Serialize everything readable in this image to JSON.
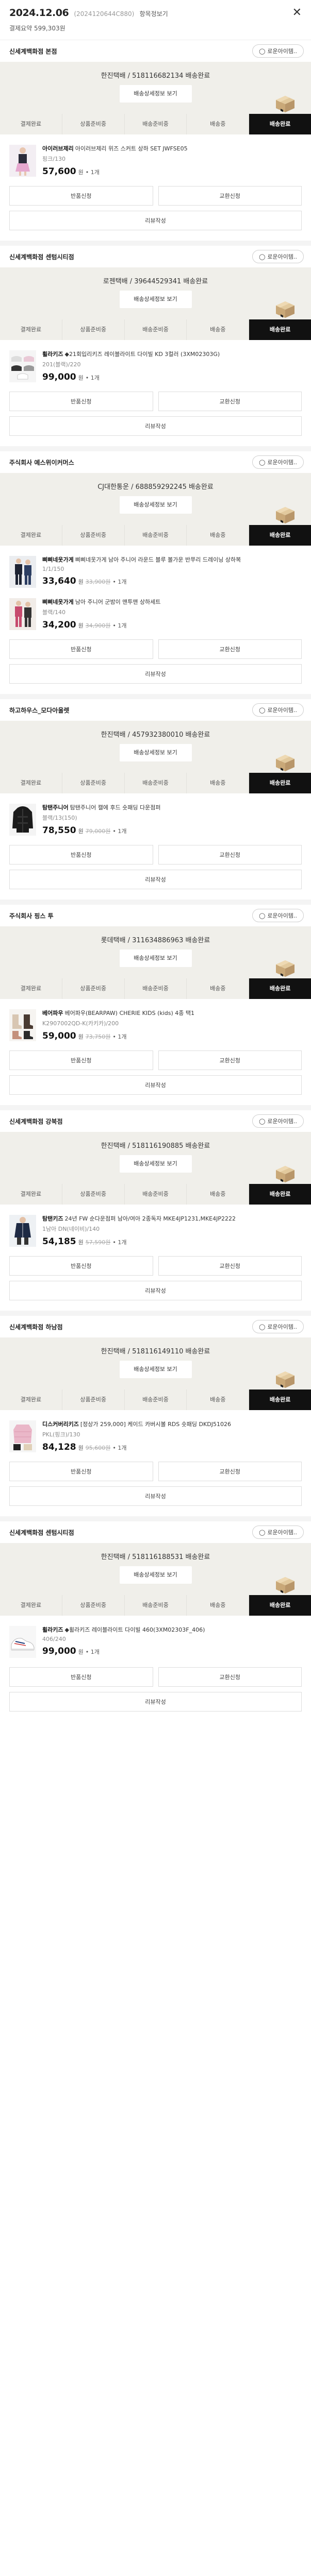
{
  "header": {
    "date": "2024.12.06",
    "order_no": "(2024120644C880)",
    "detail_link": "항목정보기",
    "payment_label": "결제요약",
    "payment_amount": "599,303원"
  },
  "labels": {
    "track_button": "배송상세정보 보기",
    "exchange_return_button": "반품신청",
    "exchange_button": "교환신청",
    "review_button": "리뷰작성",
    "shop_inquiry_button": "로운아이템..",
    "steps": [
      "결제완료",
      "상품준비중",
      "배송준비중",
      "배송중",
      "배송완료"
    ],
    "active_step": 4
  },
  "shops": [
    {
      "shop_name": "신세계백화점 본점",
      "carrier": "한진택배 / 518116682134 배송완료",
      "items": [
        {
          "brand": "아이러브제리",
          "name": "아이러브제리 위즈 스커트 상하 SET JWFSE05",
          "option": "핑크/130",
          "price": "57,600",
          "orig": "",
          "qty": "1개",
          "thumb": "pink"
        }
      ]
    },
    {
      "shop_name": "신세계백화점 센텀시티점",
      "carrier": "로젠택배 / 39644529341 배송완료",
      "items": [
        {
          "brand": "휠라키즈",
          "name": "◆21회입리키즈 레이블라이트 다이빌 KD 3컬러 (3XM02303G)",
          "option": "201(블랙)/220",
          "price": "99,000",
          "orig": "",
          "qty": "1개",
          "thumb": "shoes"
        }
      ]
    },
    {
      "shop_name": "주식회사 예스위이커머스",
      "carrier": "CJ대한통운 / 688859292245 배송완료",
      "items": [
        {
          "brand": "삐삐네옷가게",
          "name": "삐삐네옷가게 남아 주니어 라운드 블루 볼가운 반쭈리 드레이닝 상하복",
          "option": "1/1/150",
          "price": "33,640",
          "orig": "33,900원",
          "qty": "1개",
          "thumb": "black"
        },
        {
          "brand": "삐삐네옷가게",
          "name": "남아 주니어 군밤이 맨투맨 상하세트",
          "option": "블랙/140",
          "price": "34,200",
          "orig": "34,900원",
          "qty": "1개",
          "thumb": "pinkset"
        }
      ]
    },
    {
      "shop_name": "하고하우스_모다아울렛",
      "carrier": "한진택배 / 457932380010 배송완료",
      "items": [
        {
          "brand": "탐탠주니어",
          "name": "탐탠주니어 캘에 후드 숏패딩 다운점퍼",
          "option": "블랙/13(150)",
          "price": "78,550",
          "orig": "79,000원",
          "qty": "1개",
          "thumb": "jacket"
        }
      ]
    },
    {
      "shop_name": "주식회사 핑스 투",
      "carrier": "롯데택배 / 311634886963 배송완료",
      "items": [
        {
          "brand": "베어파우",
          "name": "베어파우(BEARPAW) CHERIE KIDS (kids) 4종 택1",
          "option": "K2907002QD-K(카키카)/200",
          "price": "59,000",
          "orig": "73,750원",
          "qty": "1개",
          "thumb": "boots"
        }
      ]
    },
    {
      "shop_name": "신세계백화점 강북점",
      "carrier": "한진택배 / 518116190885 배송완료",
      "items": [
        {
          "brand": "탐탠키즈",
          "name": "24년 FW 순다운점퍼 남아/여아 2종독자 MKE4JP1231,MKE4JP2222",
          "option": "1남아 DN(네이비)/140",
          "price": "54,185",
          "orig": "57,590원",
          "qty": "1개",
          "thumb": "parka"
        }
      ]
    },
    {
      "shop_name": "신세계백화점 하남점",
      "carrier": "한진택배 / 518116149110 배송완료",
      "items": [
        {
          "brand": "디스커버리키즈",
          "name": "[정상가 259,000] 케이드 카버시볼 RDS 숏패딩 DKDJ51026",
          "option": "PKL(핑크)/130",
          "price": "84,128",
          "orig": "95,600원",
          "qty": "1개",
          "thumb": "puffer"
        }
      ]
    },
    {
      "shop_name": "신세계백화점 센텀시티점",
      "carrier": "한진택배 / 518116188531 배송완료",
      "items": [
        {
          "brand": "휠라키즈",
          "name": "◆휠라키즈 레이블라이트 다이빌 460(3XM02303F_406)",
          "option": "406/240",
          "price": "99,000",
          "orig": "",
          "qty": "1개",
          "thumb": "sneaker"
        }
      ]
    }
  ]
}
